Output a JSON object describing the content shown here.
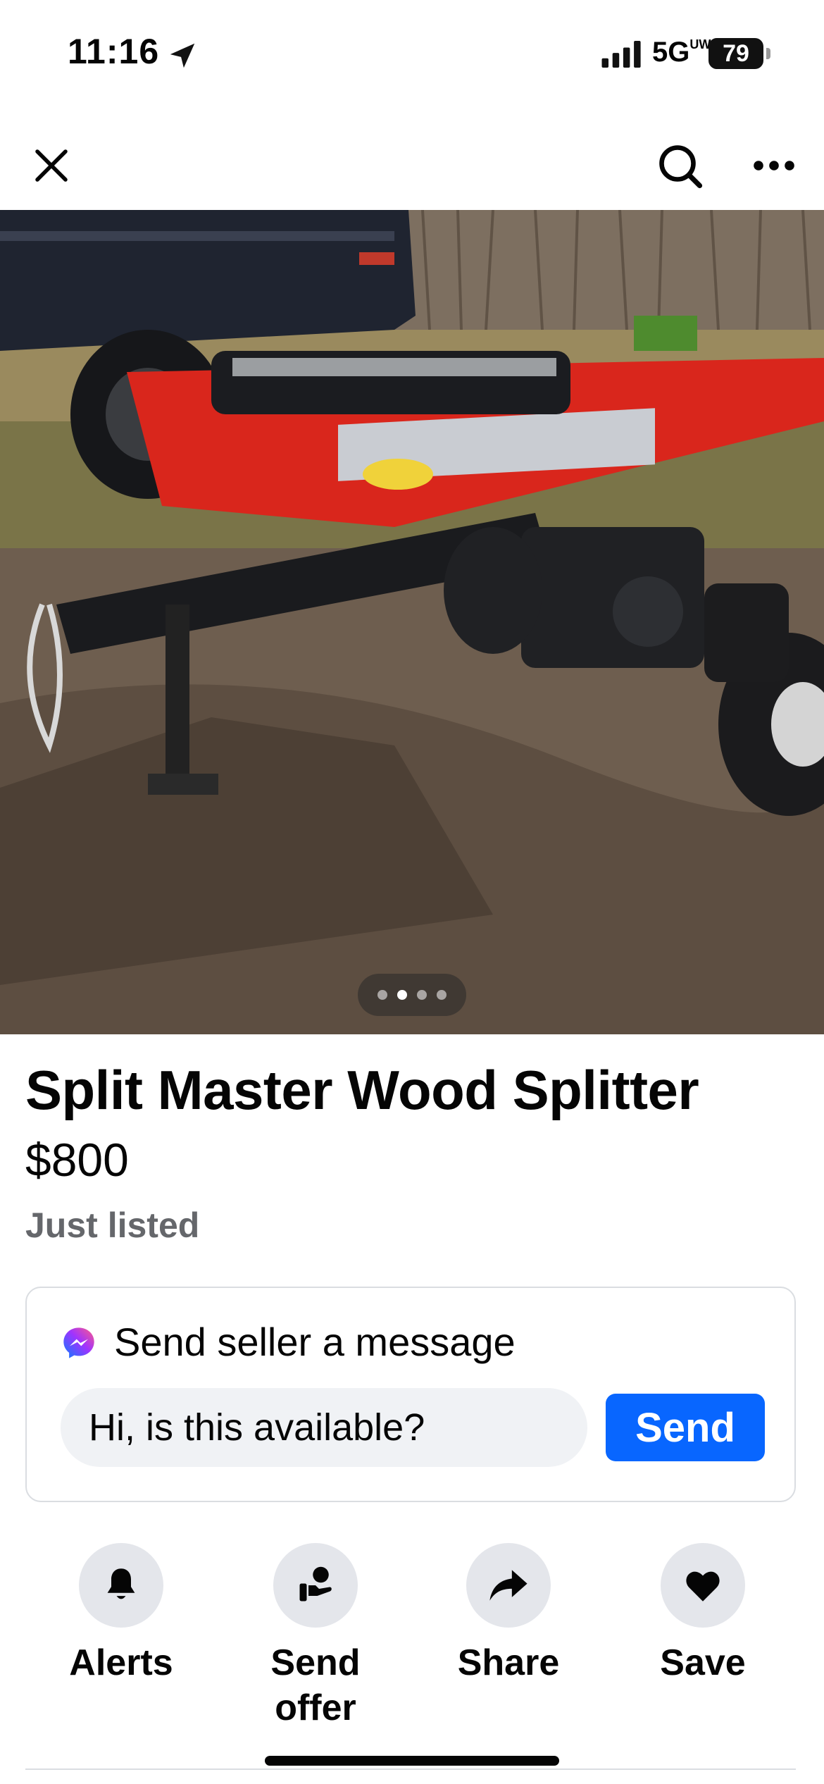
{
  "status_bar": {
    "time": "11:16",
    "network": "5G",
    "network_suffix": "UW",
    "battery": "79"
  },
  "nav": {
    "close_icon": "close-icon",
    "search_icon": "search-icon",
    "more_icon": "more-horizontal-icon"
  },
  "photo": {
    "pager_total": 4,
    "pager_active": 2
  },
  "listing": {
    "title": "Split Master Wood Splitter",
    "price": "$800",
    "status": "Just listed"
  },
  "message": {
    "heading": "Send seller a message",
    "input_value": "Hi, is this available?",
    "send_label": "Send",
    "accent": "#0866ff"
  },
  "actions": [
    {
      "label": "Alerts",
      "icon": "bell-icon"
    },
    {
      "label": "Send offer",
      "icon": "send-offer-icon"
    },
    {
      "label": "Share",
      "icon": "share-arrow-icon"
    },
    {
      "label": "Save",
      "icon": "heart-icon"
    }
  ]
}
